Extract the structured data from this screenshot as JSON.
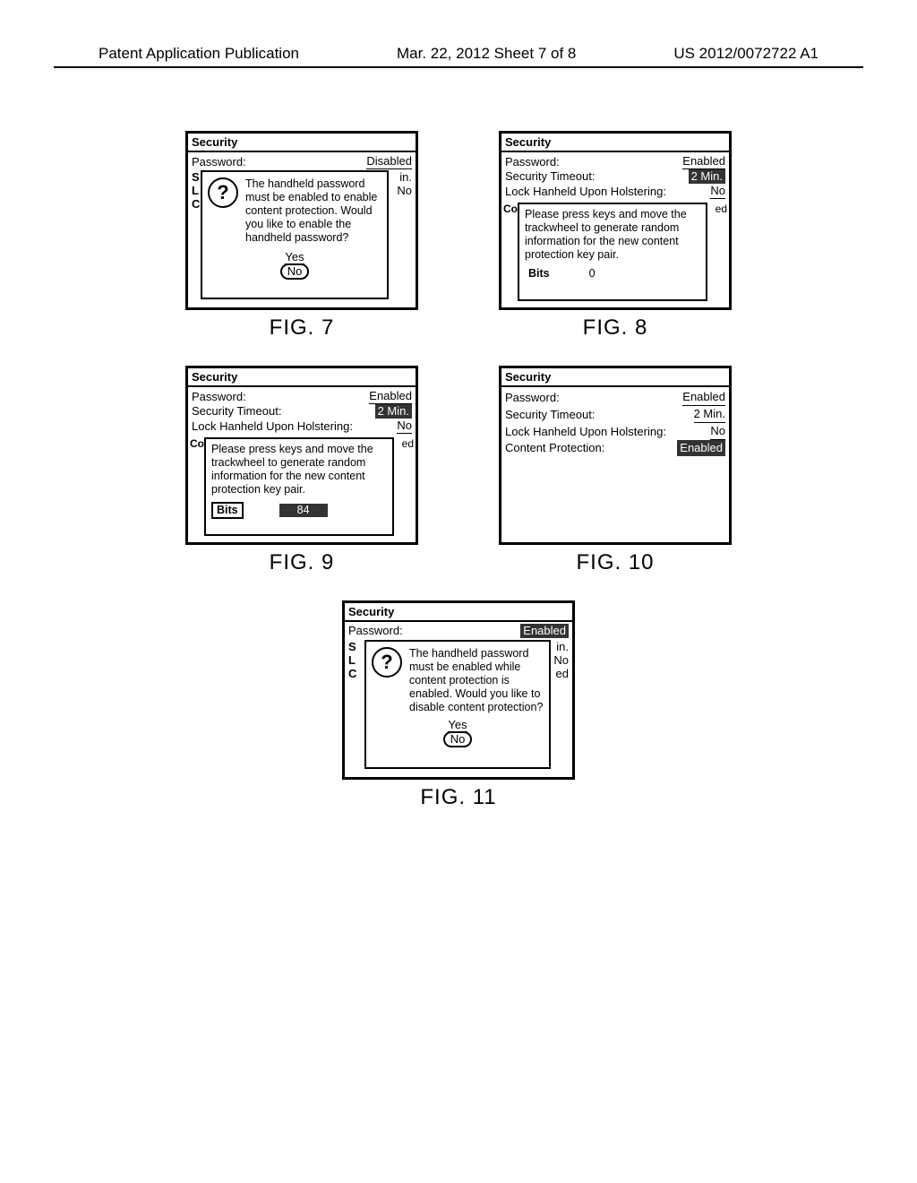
{
  "header": {
    "left": "Patent Application Publication",
    "middle": "Mar. 22, 2012  Sheet 7 of 8",
    "right": "US 2012/0072722 A1"
  },
  "common": {
    "security_title": "Security",
    "password_label": "Password:",
    "timeout_label": "Security Timeout:",
    "lock_label": "Lock Hanheld Upon Holstering:",
    "content_prot_label": "Content Protection:",
    "enabled": "Enabled",
    "disabled": "Disabled",
    "two_min": "2 Min.",
    "no": "No",
    "yes": "Yes",
    "keygen_text": "Please press keys and move the trackwheel to generate random information for the new content protection key pair.",
    "bits_label": "Bits"
  },
  "fig7": {
    "caption": "FIG. 7",
    "dialog": "The handheld password must be enabled to enable content protection.  Would you like to enable the handheld password?",
    "bg_left": "S\nL\nC",
    "bg_right": "in.\nNo"
  },
  "fig8": {
    "caption": "FIG. 8",
    "bits_value": "0",
    "co": "Co",
    "ed": "ed"
  },
  "fig9": {
    "caption": "FIG. 9",
    "bits_value": "84",
    "co": "Co",
    "ed": "ed"
  },
  "fig10": {
    "caption": "FIG. 10"
  },
  "fig11": {
    "caption": "FIG. 11",
    "dialog": "The handheld password must be enabled while content protection is enabled. Would you like to disable content protection?",
    "bg_left": "S\nL\nC",
    "bg_right": "in.\nNo\ned"
  }
}
